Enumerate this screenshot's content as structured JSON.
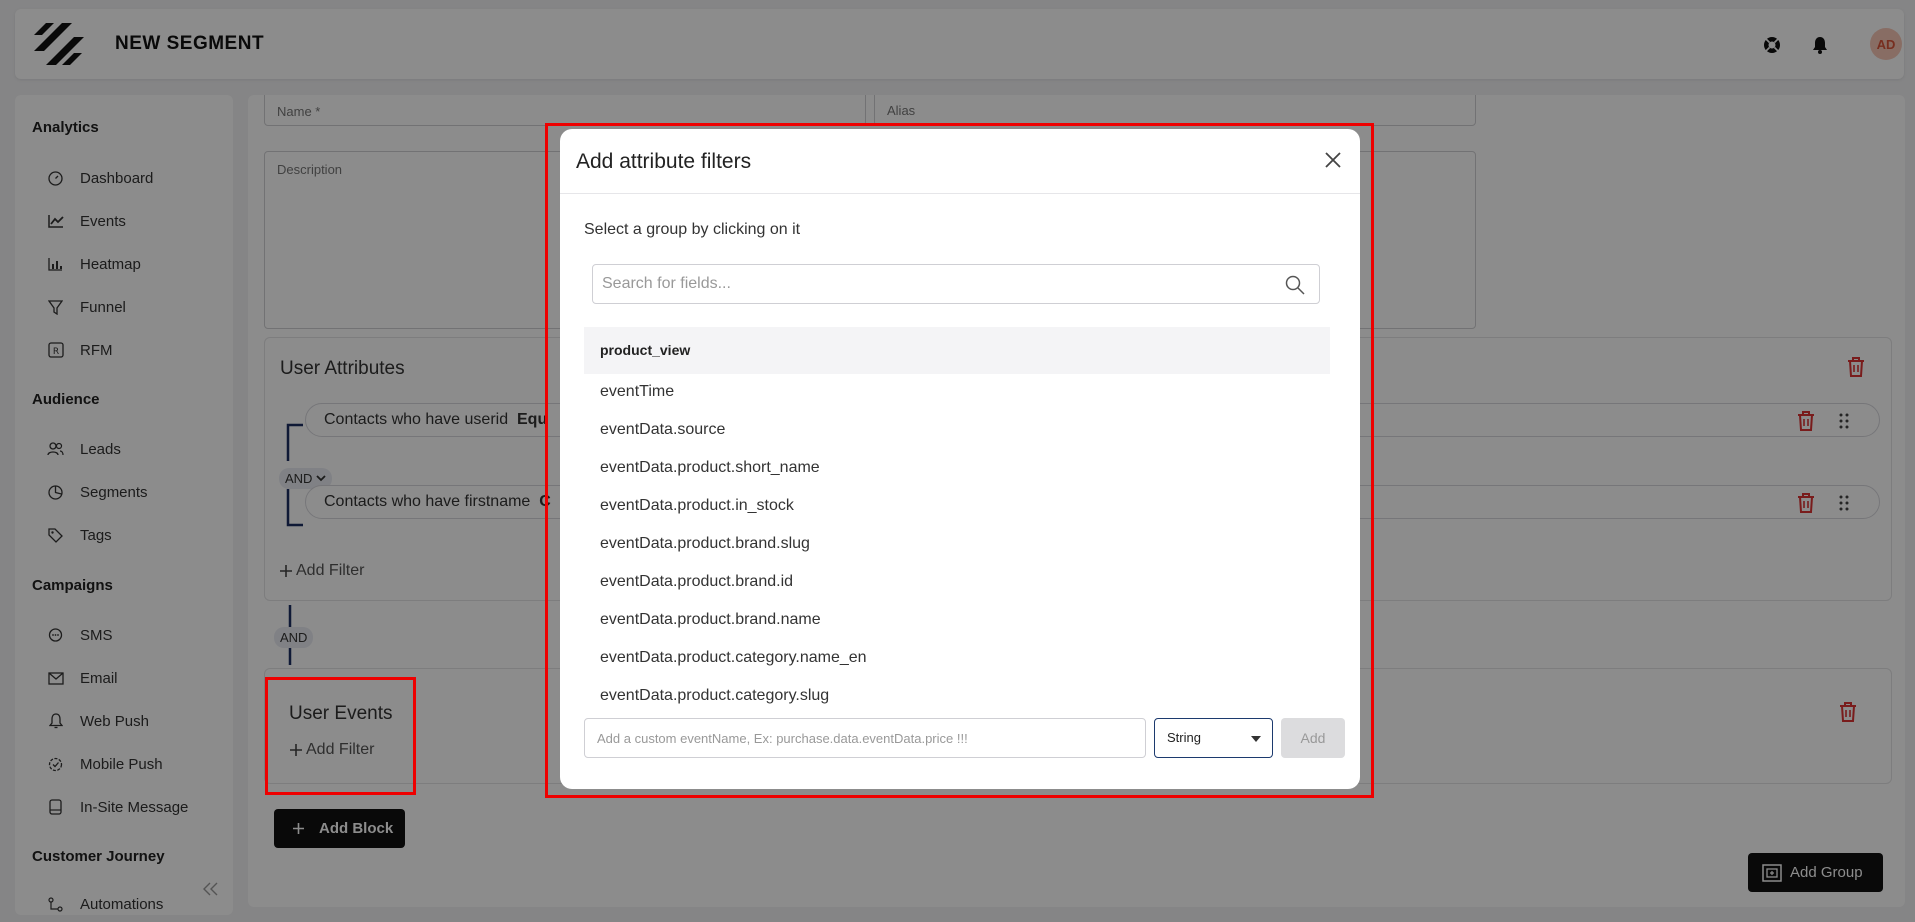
{
  "header": {
    "title": "NEW SEGMENT",
    "avatar_initials": "AD"
  },
  "sidebar": {
    "collapse_icon": "double-chevron-left-icon",
    "sections": [
      {
        "label": "Analytics",
        "items": [
          "Dashboard",
          "Events",
          "Heatmap",
          "Funnel",
          "RFM"
        ]
      },
      {
        "label": "Audience",
        "items": [
          "Leads",
          "Segments",
          "Tags"
        ]
      },
      {
        "label": "Campaigns",
        "items": [
          "SMS",
          "Email",
          "Web Push",
          "Mobile Push",
          "In-Site Message"
        ]
      },
      {
        "label": "Customer Journey",
        "items": [
          "Automations"
        ]
      }
    ]
  },
  "form": {
    "name_placeholder": "Name *",
    "alias_placeholder": "Alias",
    "description_placeholder": "Description"
  },
  "user_attributes": {
    "title": "User Attributes",
    "filters": [
      "Contacts who have userid",
      "Contacts who have firstname"
    ],
    "filter_ops": [
      "Equ",
      "C"
    ],
    "operator": "AND",
    "add_filter": "Add Filter"
  },
  "block_operator": "AND",
  "user_events": {
    "title": "User Events",
    "add_filter": "Add Filter"
  },
  "buttons": {
    "add_block": "Add Block",
    "add_group": "Add Group"
  },
  "modal": {
    "title": "Add attribute filters",
    "hint": "Select a group by clicking on it",
    "search_placeholder": "Search for fields...",
    "group": "product_view",
    "fields": [
      "eventTime",
      "eventData.source",
      "eventData.product.short_name",
      "eventData.product.in_stock",
      "eventData.product.brand.slug",
      "eventData.product.brand.id",
      "eventData.product.brand.name",
      "eventData.product.category.name_en",
      "eventData.product.category.slug"
    ],
    "custom_placeholder": "Add a custom eventName, Ex: purchase.data.eventData.price !!!",
    "type_value": "String",
    "add_label": "Add"
  },
  "colors": {
    "highlight": "#ee0000",
    "trash": "#d33",
    "dark_button": "#111111"
  }
}
